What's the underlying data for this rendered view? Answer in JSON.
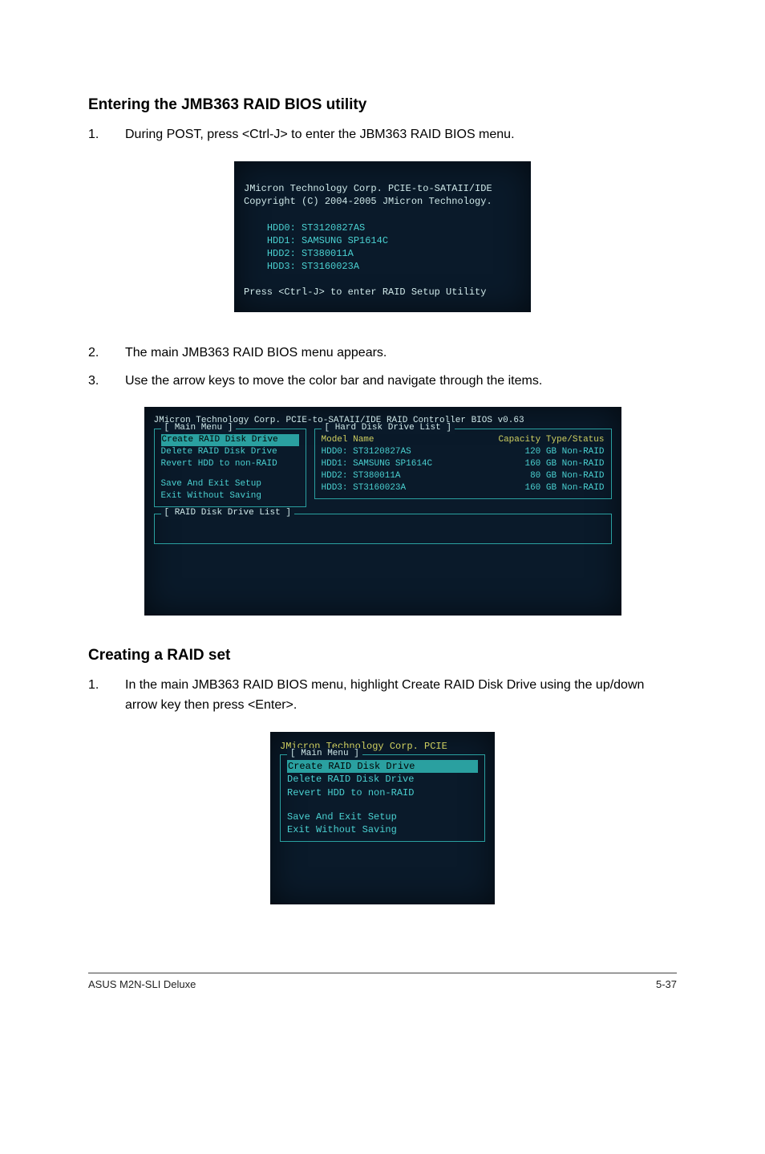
{
  "sections": {
    "enter_title": "Entering the JMB363 RAID BIOS utility",
    "create_title": "Creating a RAID set"
  },
  "steps_enter": [
    {
      "num": "1.",
      "text": "During POST, press <Ctrl-J> to enter the JBM363 RAID BIOS menu."
    },
    {
      "num": "2.",
      "text": "The main JMB363 RAID BIOS menu appears."
    },
    {
      "num": "3.",
      "text": "Use the arrow keys to move the color bar and navigate through the items."
    }
  ],
  "steps_create": [
    {
      "num": "1.",
      "text": "In the main JMB363 RAID BIOS menu, highlight Create RAID Disk Drive using the up/down arrow key then press <Enter>."
    }
  ],
  "bios1": {
    "line1": "JMicron Technology Corp. PCIE-to-SATAII/IDE",
    "line2": "Copyright (C) 2004-2005 JMicron Technology.",
    "h0": "HDD0: ST3120827AS",
    "h1": "HDD1: SAMSUNG SP1614C",
    "h2": "HDD2: ST380011A",
    "h3": "HDD3: ST3160023A",
    "prompt": "Press <Ctrl-J> to enter RAID Setup Utility"
  },
  "bios2": {
    "header": "JMicron Technology Corp. PCIE-to-SATAII/IDE RAID Controller BIOS v0.63",
    "main_title": "[ Main Menu ]",
    "list_title": "[ Hard Disk Drive List ]",
    "raid_list_title": "[ RAID Disk Drive List ]",
    "col_model": "Model Name",
    "col_cap": "Capacity Type/Status",
    "m1": "Create RAID Disk Drive",
    "m2": "Delete RAID Disk Drive",
    "m3": "Revert HDD to non-RAID",
    "m4": "Save And Exit Setup",
    "m5": "Exit Without Saving",
    "d0": "HDD0: ST3120827AS",
    "d1": "HDD1: SAMSUNG SP1614C",
    "d2": "HDD2: ST380011A",
    "d3": "HDD3: ST3160023A",
    "c0": "120 GB Non-RAID",
    "c1": "160 GB Non-RAID",
    "c2": " 80 GB Non-RAID",
    "c3": "160 GB Non-RAID"
  },
  "bios3": {
    "header": "JMicron Technology Corp. PCIE",
    "main_title": "[ Main Menu ]",
    "m1": "Create RAID Disk Drive",
    "m2": "Delete RAID Disk Drive",
    "m3": "Revert HDD to non-RAID",
    "m4": "Save And Exit Setup",
    "m5": "Exit Without Saving"
  },
  "footer": {
    "left": "ASUS M2N-SLI Deluxe",
    "right": "5-37"
  }
}
